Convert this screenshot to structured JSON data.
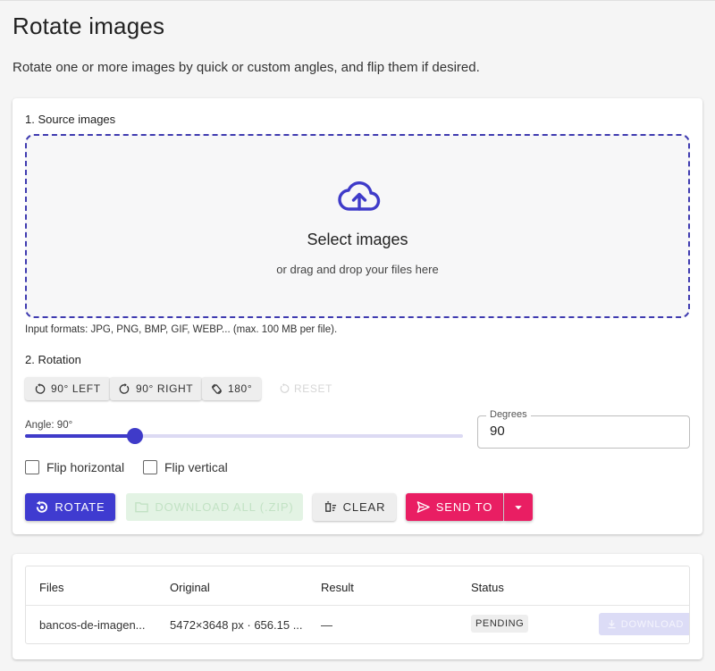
{
  "page": {
    "title": "Rotate images",
    "subtitle": "Rotate one or more images by quick or custom angles, and flip them if desired."
  },
  "source": {
    "section_label": "1. Source images",
    "dropzone_title": "Select images",
    "dropzone_hint": "or drag and drop your files here",
    "formats_note": "Input formats: JPG, PNG, BMP, GIF, WEBP... (max. 100 MB per file)."
  },
  "rotation": {
    "section_label": "2. Rotation",
    "quick_buttons": {
      "left": "90° LEFT",
      "right": "90° RIGHT",
      "half": "180°",
      "reset": "RESET"
    },
    "angle_label": "Angle: 90°",
    "slider": {
      "value": 90,
      "min": 0,
      "max": 360
    },
    "degrees_label": "Degrees",
    "degrees_value": "90",
    "flip_horizontal_label": "Flip horizontal",
    "flip_horizontal_checked": false,
    "flip_vertical_label": "Flip vertical",
    "flip_vertical_checked": false
  },
  "actions": {
    "rotate": "ROTATE",
    "download_all": "DOWNLOAD ALL (.ZIP)",
    "clear": "CLEAR",
    "send_to": "SEND TO"
  },
  "files_table": {
    "headers": {
      "files": "Files",
      "original": "Original",
      "result": "Result",
      "status": "Status"
    },
    "rows": [
      {
        "file": "bancos-de-imagen...",
        "original": "5472×3648 px · 656.15 ...",
        "result": "—",
        "status": "PENDING",
        "download": "DOWNLOAD"
      }
    ]
  },
  "colors": {
    "primary": "#3f3bd0",
    "accent": "#e91e63",
    "dropzone_border": "#3f3bb0",
    "disabled_green": "#e3f3e4"
  }
}
